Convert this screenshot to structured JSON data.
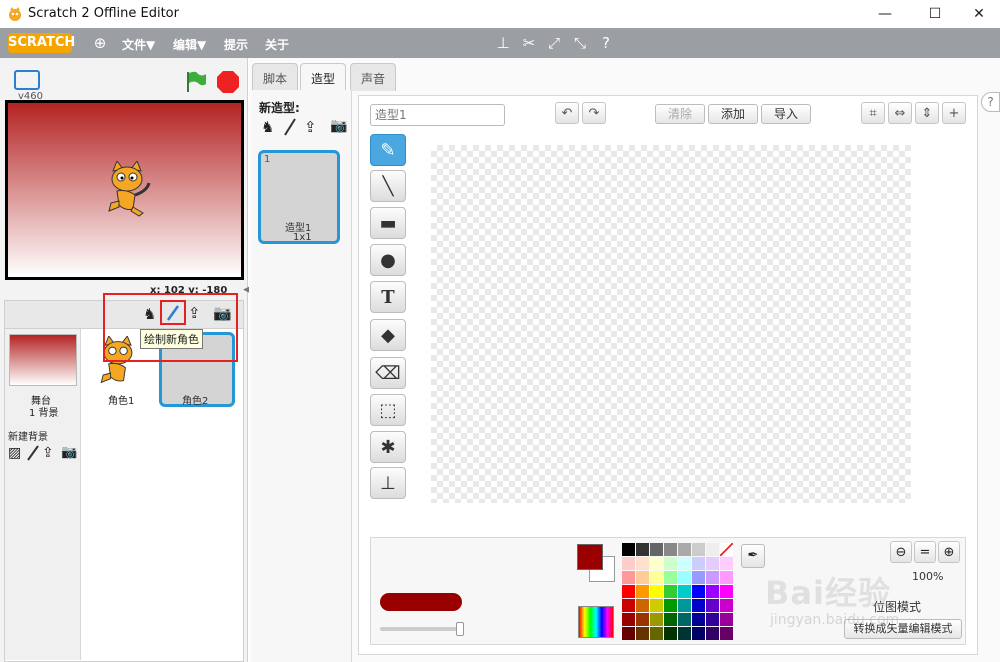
{
  "window": {
    "title": "Scratch 2 Offline Editor",
    "minimize": "—",
    "maximize": "☐",
    "close": "✕"
  },
  "menu": {
    "logo": "SCRATCH",
    "file": "文件▼",
    "edit": "编辑▼",
    "tips": "提示",
    "about": "关于"
  },
  "stage": {
    "version": "v460",
    "coords": "x: 102  y: -180"
  },
  "sprites": {
    "stage_label": "舞台",
    "stage_backdrops": "1 背景",
    "new_backdrop": "新建背景",
    "items": [
      {
        "label": "角色1"
      },
      {
        "label": "角色2"
      }
    ],
    "tooltip": "绘制新角色"
  },
  "tabs": [
    {
      "label": "脚本"
    },
    {
      "label": "造型"
    },
    {
      "label": "声音"
    }
  ],
  "costumes": {
    "new_label": "新造型:",
    "items": [
      {
        "index": "1",
        "name": "造型1",
        "size": "1x1"
      }
    ]
  },
  "editor": {
    "name_placeholder": "造型1",
    "clear": "清除",
    "add": "添加",
    "import": "导入",
    "zoom_level": "100%",
    "mode_label": "位图模式",
    "convert": "转换成矢量编辑模式"
  },
  "colors": {
    "selected": "#9b0000",
    "stage_top": "#b42323",
    "accent": "#2596d6",
    "grays": [
      "#000000",
      "#333333",
      "#666666",
      "#888888",
      "#aaaaaa",
      "#cccccc",
      "#eeeeee"
    ],
    "rows": [
      [
        "#ffcccc",
        "#ffe0cc",
        "#ffffcc",
        "#ccffcc",
        "#ccffff",
        "#ccccff",
        "#e5ccff",
        "#ffccff"
      ],
      [
        "#ff9999",
        "#ffcc99",
        "#ffff99",
        "#99ff99",
        "#99ffff",
        "#9999ff",
        "#cc99ff",
        "#ff99ff"
      ],
      [
        "#ff0000",
        "#ff9900",
        "#ffff00",
        "#33cc33",
        "#00cccc",
        "#0000ff",
        "#9900ff",
        "#ff00ff"
      ],
      [
        "#cc0000",
        "#cc6600",
        "#cccc00",
        "#009900",
        "#009999",
        "#0000cc",
        "#6600cc",
        "#cc00cc"
      ],
      [
        "#990000",
        "#993300",
        "#999900",
        "#006600",
        "#006666",
        "#000099",
        "#330099",
        "#990099"
      ],
      [
        "#660000",
        "#663300",
        "#666600",
        "#003300",
        "#003333",
        "#000066",
        "#330066",
        "#660066"
      ]
    ]
  },
  "watermark": {
    "brand": "Bai经验",
    "url": "jingyan.baidu.com"
  }
}
